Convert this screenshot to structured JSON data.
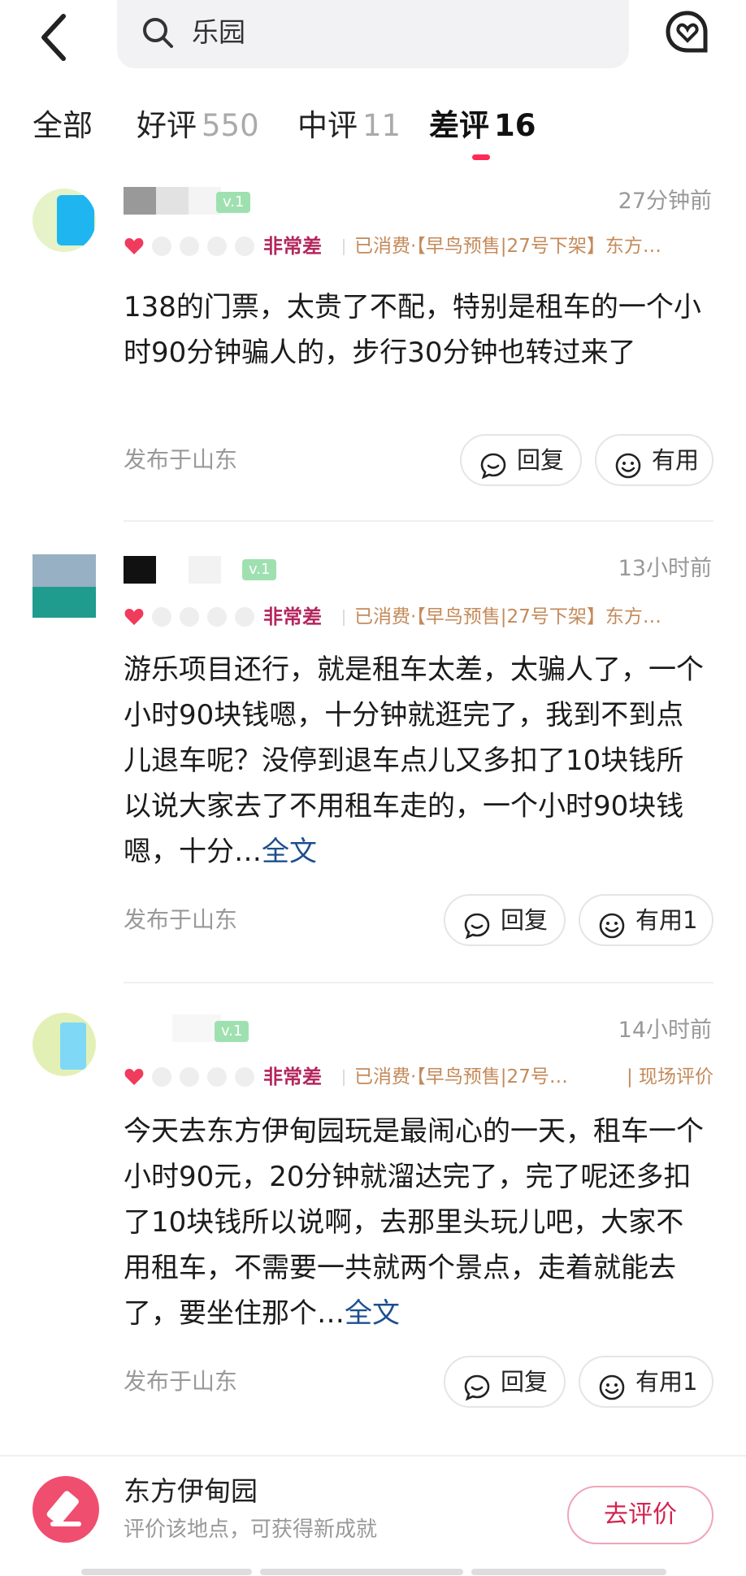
{
  "search": {
    "query": "乐园"
  },
  "tabs": [
    {
      "label": "全部",
      "count": ""
    },
    {
      "label": "好评",
      "count": "550"
    },
    {
      "label": "中评",
      "count": "11"
    },
    {
      "label": "差评",
      "count": "16"
    }
  ],
  "icons": {
    "back": "back-arrow-icon",
    "search": "search-icon",
    "heart": "heart-chat-icon",
    "rating": "heart-icon",
    "reply": "comment-icon",
    "helpful": "smile-icon"
  },
  "colors": {
    "accent": "#ff2a55",
    "rating_text": "#b3265d",
    "meta_text": "#c48a5a",
    "link": "#1e4f8f"
  },
  "reviews": [
    {
      "level": "v.1",
      "time": "27分钟前",
      "rating_count": 1,
      "rating_label": "非常差",
      "meta": "已消费·【早鸟预售|27号下架】东方…",
      "meta_extra": "",
      "body": "138的门票，太贵了不配，特别是租车的一个小时90分钟骗人的，步行30分钟也转过来了",
      "more": "",
      "location": "发布于山东",
      "reply_label": "回复",
      "helpful_label": "有用"
    },
    {
      "level": "v.1",
      "time": "13小时前",
      "rating_count": 1,
      "rating_label": "非常差",
      "meta": "已消费·【早鸟预售|27号下架】东方…",
      "meta_extra": "",
      "body": "游乐项目还行，就是租车太差，太骗人了，一个小时90块钱嗯，十分钟就逛完了，我到不到点儿退车呢？没停到退车点儿又多扣了10块钱所以说大家去了不用租车走的，一个小时90块钱嗯，十分…",
      "more": "全文",
      "location": "发布于山东",
      "reply_label": "回复",
      "helpful_label": "有用1"
    },
    {
      "level": "v.1",
      "time": "14小时前",
      "rating_count": 1,
      "rating_label": "非常差",
      "meta": "已消费·【早鸟预售|27号…",
      "meta_extra": "| 现场评价",
      "body": "今天去东方伊甸园玩是最闹心的一天，租车一个小时90元，20分钟就溜达完了，完了呢还多扣了10块钱所以说啊，去那里头玩儿吧，大家不用租车，不需要一共就两个景点，走着就能去了，要坐住那个…",
      "more": "全文",
      "location": "发布于山东",
      "reply_label": "回复",
      "helpful_label": "有用1"
    }
  ],
  "footer": {
    "place_name": "东方伊甸园",
    "subtitle": "评价该地点，可获得新成就",
    "button_label": "去评价"
  }
}
